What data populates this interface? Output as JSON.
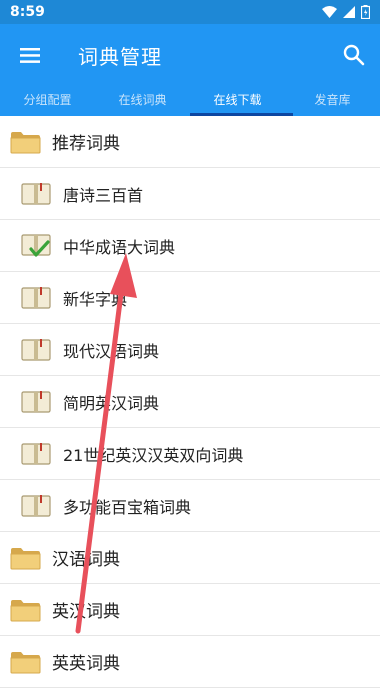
{
  "status": {
    "time": "8:59"
  },
  "appbar": {
    "title": "词典管理"
  },
  "tabs": [
    {
      "label": "分组配置"
    },
    {
      "label": "在线词典"
    },
    {
      "label": "在线下载"
    },
    {
      "label": "发音库"
    }
  ],
  "active_tab": "在线下载",
  "list": {
    "group_recommended": "推荐词典",
    "items": [
      {
        "label": "唐诗三百首",
        "installed": false
      },
      {
        "label": "中华成语大词典",
        "installed": true
      },
      {
        "label": "新华字典",
        "installed": false
      },
      {
        "label": "现代汉语词典",
        "installed": false
      },
      {
        "label": "简明英汉词典",
        "installed": false
      },
      {
        "label": "21世纪英汉汉英双向词典",
        "installed": false
      },
      {
        "label": "多功能百宝箱词典",
        "installed": false
      }
    ],
    "groups": [
      {
        "label": "汉语词典"
      },
      {
        "label": "英汉词典"
      },
      {
        "label": "英英词典"
      }
    ]
  },
  "colors": {
    "appbar": "#2196f3",
    "statusbar": "#1e88d6",
    "indicator": "#0d47a1",
    "arrow": "#e8505b"
  }
}
